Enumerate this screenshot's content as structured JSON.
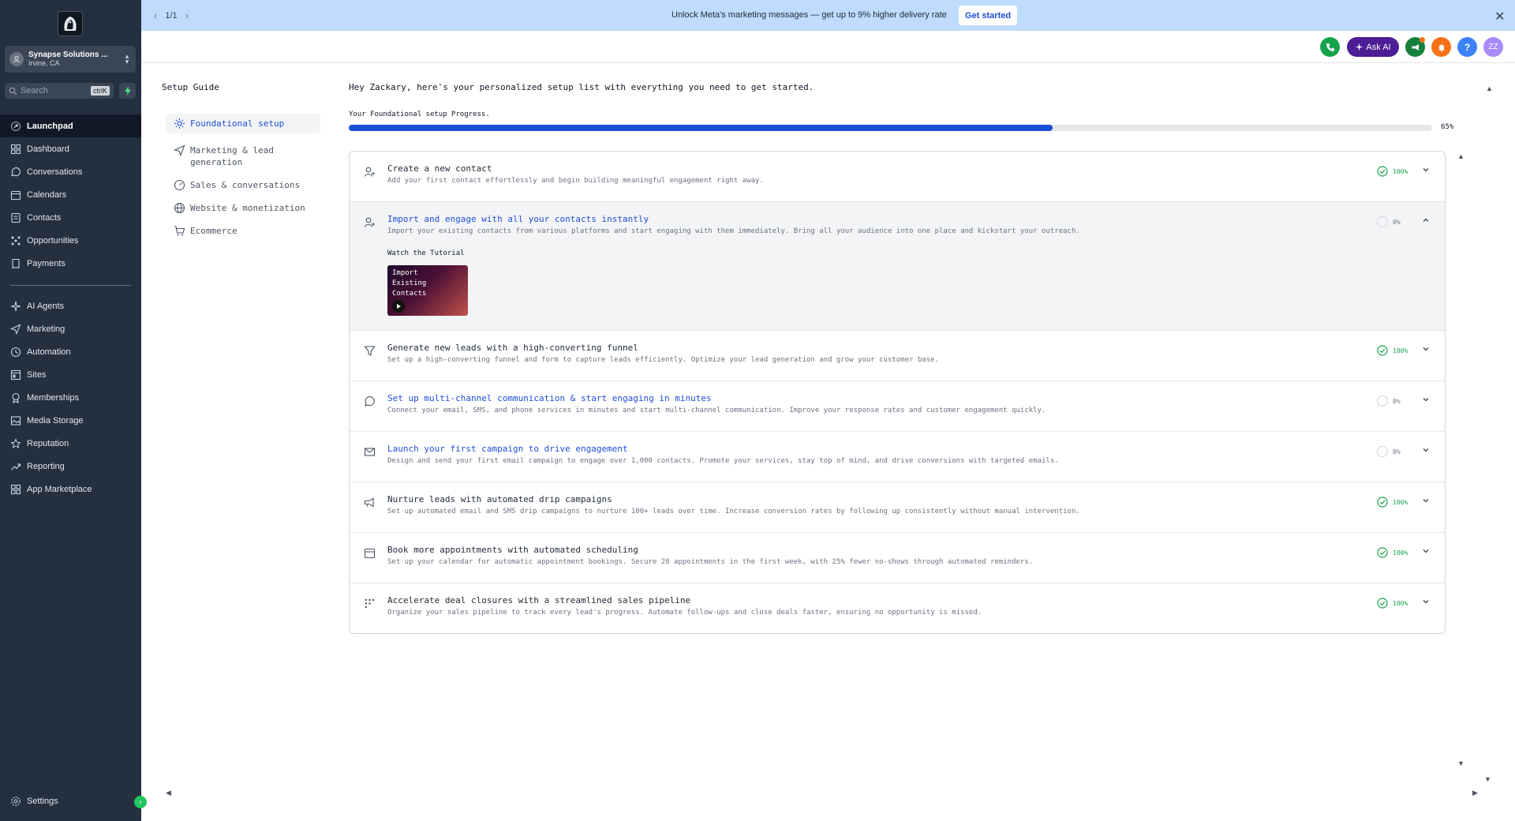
{
  "sidebar": {
    "account": {
      "name": "Synapse Solutions ...",
      "location": "Irvine, CA"
    },
    "search": {
      "placeholder": "Search",
      "shortcut": "ctrlK"
    },
    "nav": [
      {
        "label": "Launchpad",
        "icon": "rocket-icon",
        "active": true
      },
      {
        "label": "Dashboard",
        "icon": "grid-icon"
      },
      {
        "label": "Conversations",
        "icon": "chat-icon"
      },
      {
        "label": "Calendars",
        "icon": "calendar-icon"
      },
      {
        "label": "Contacts",
        "icon": "contacts-icon"
      },
      {
        "label": "Opportunities",
        "icon": "network-icon"
      },
      {
        "label": "Payments",
        "icon": "receipt-icon"
      }
    ],
    "nav2": [
      {
        "label": "AI Agents",
        "icon": "sparkle-icon"
      },
      {
        "label": "Marketing",
        "icon": "send-icon"
      },
      {
        "label": "Automation",
        "icon": "automation-icon"
      },
      {
        "label": "Sites",
        "icon": "sites-icon"
      },
      {
        "label": "Memberships",
        "icon": "badge-icon"
      },
      {
        "label": "Media Storage",
        "icon": "image-icon"
      },
      {
        "label": "Reputation",
        "icon": "star-icon"
      },
      {
        "label": "Reporting",
        "icon": "trend-icon"
      },
      {
        "label": "App Marketplace",
        "icon": "apps-icon"
      }
    ],
    "settings": "Settings"
  },
  "banner": {
    "pager": "1/1",
    "message": "Unlock Meta's marketing messages — get up to 9% higher delivery rate",
    "cta": "Get started"
  },
  "header": {
    "ask_ai": "Ask AI",
    "help": "?",
    "avatar": "ZZ"
  },
  "guide": {
    "title": "Setup Guide",
    "sections": [
      {
        "label": "Foundational setup",
        "active": true
      },
      {
        "label": "Marketing & lead generation"
      },
      {
        "label": "Sales & conversations"
      },
      {
        "label": "Website & monetization"
      },
      {
        "label": "Ecommerce"
      }
    ]
  },
  "main": {
    "greeting": "Hey Zackary, here's your personalized setup list with everything you need to get started.",
    "progress_label": "Your Foundational setup Progress.",
    "progress_value": 65,
    "progress_text": "65%",
    "tutorial_label": "Watch the Tutorial",
    "tutorial_thumb": "Import Existing Contacts",
    "tasks": [
      {
        "title": "Create a new contact",
        "desc": "Add your first contact effortlessly and begin building meaningful engagement right away.",
        "status": "100%"
      },
      {
        "title": "Import and engage with all your contacts instantly",
        "desc": "Import your existing contacts from various platforms and start engaging with them immediately. Bring all your audience into one place and kickstart your outreach.",
        "status": "0%"
      },
      {
        "title": "Generate new leads with a high-converting funnel",
        "desc": "Set up a high-converting funnel and form to capture leads efficiently. Optimize your lead generation and grow your customer base.",
        "status": "100%"
      },
      {
        "title": "Set up multi-channel communication & start engaging in minutes",
        "desc": "Connect your email, SMS, and phone services in minutes and start multi-channel communication. Improve your response rates and customer engagement quickly.",
        "status": "0%"
      },
      {
        "title": "Launch your first campaign to drive engagement",
        "desc": "Design and send your first email campaign to engage over 1,000 contacts. Promote your services, stay top of mind, and drive conversions with targeted emails.",
        "status": "0%"
      },
      {
        "title": "Nurture leads with automated drip campaigns",
        "desc": "Set up automated email and SMS drip campaigns to nurture 100+ leads over time. Increase conversion rates by following up consistently without manual intervention.",
        "status": "100%"
      },
      {
        "title": "Book more appointments with automated scheduling",
        "desc": "Set up your calendar for automatic appointment bookings. Secure 20 appointments in the first week, with 25% fewer no-shows through automated reminders.",
        "status": "100%"
      },
      {
        "title": "Accelerate deal closures with a streamlined sales pipeline",
        "desc": "Organize your sales pipeline to track every lead's progress. Automate follow-ups and close deals faster, ensuring no opportunity is missed.",
        "status": "100%"
      }
    ]
  }
}
